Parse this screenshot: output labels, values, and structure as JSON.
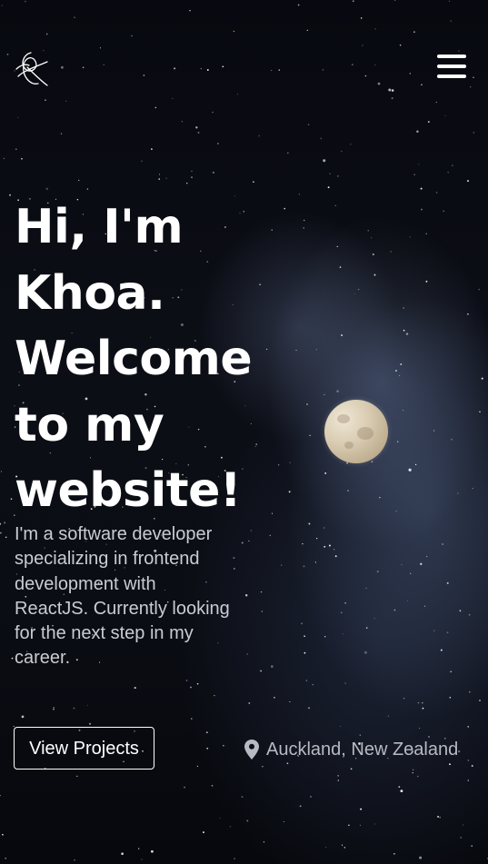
{
  "header": {
    "logo_icon": "signature-logo-icon",
    "menu_icon": "hamburger-menu-icon"
  },
  "hero": {
    "headline_lines": [
      "Hi, I'm",
      "Khoa.",
      "Welcome",
      "to my",
      "website!"
    ],
    "intro_lines": [
      "I'm a software developer",
      "specializing in frontend",
      "development with",
      "ReactJS. Currently looking",
      "for the next step in my",
      "career."
    ],
    "cta_label": "View Projects",
    "location_icon": "map-pin-icon",
    "location_text": "Auckland, New Zealand"
  },
  "colors": {
    "background": "#0b0d14",
    "text": "#ffffff",
    "muted_text": "#c9ccd3",
    "nebula": "#5a698c",
    "moon": "#d9ccb3"
  }
}
